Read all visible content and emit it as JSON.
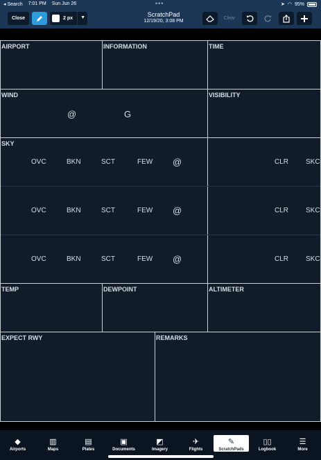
{
  "status_bar": {
    "carrier": "◂ Search",
    "time": "7:01 PM",
    "date": "Sun Jun 26",
    "dots": "•••",
    "battery": "95%"
  },
  "toolbar": {
    "close": "Close",
    "pen_size": "2 px",
    "title": "ScratchPad",
    "timestamp": "12/19/20, 3:08 PM",
    "clear": "Clear"
  },
  "form": {
    "airport": "AIRPORT",
    "information": "INFORMATION",
    "time": "TIME",
    "wind": "WIND",
    "wind_at": "@",
    "wind_gust": "G",
    "visibility": "VISIBILITY",
    "sky": "SKY",
    "sky_rows": [
      {
        "ovc": "OVC",
        "bkn": "BKN",
        "sct": "SCT",
        "few": "FEW",
        "at": "@",
        "clr": "CLR",
        "skc": "SKC"
      },
      {
        "ovc": "OVC",
        "bkn": "BKN",
        "sct": "SCT",
        "few": "FEW",
        "at": "@",
        "clr": "CLR",
        "skc": "SKC"
      },
      {
        "ovc": "OVC",
        "bkn": "BKN",
        "sct": "SCT",
        "few": "FEW",
        "at": "@",
        "clr": "CLR",
        "skc": "SKC"
      }
    ],
    "temp": "TEMP",
    "dewpoint": "DEWPOINT",
    "altimeter": "ALTIMETER",
    "expect_rwy": "EXPECT RWY",
    "remarks": "REMARKS"
  },
  "tabs": [
    {
      "label": "Airports",
      "icon": "airports-icon"
    },
    {
      "label": "Maps",
      "icon": "maps-icon"
    },
    {
      "label": "Plates",
      "icon": "plates-icon"
    },
    {
      "label": "Documents",
      "icon": "documents-icon"
    },
    {
      "label": "Imagery",
      "icon": "imagery-icon"
    },
    {
      "label": "Flights",
      "icon": "flights-icon"
    },
    {
      "label": "ScratchPads",
      "icon": "scratchpads-icon",
      "active": true
    },
    {
      "label": "Logbook",
      "icon": "logbook-icon"
    },
    {
      "label": "More",
      "icon": "more-icon"
    }
  ],
  "colors": {
    "toolbar_bg": "#1c3756",
    "form_bg": "#111c2b",
    "accent": "#2e9bdc"
  }
}
